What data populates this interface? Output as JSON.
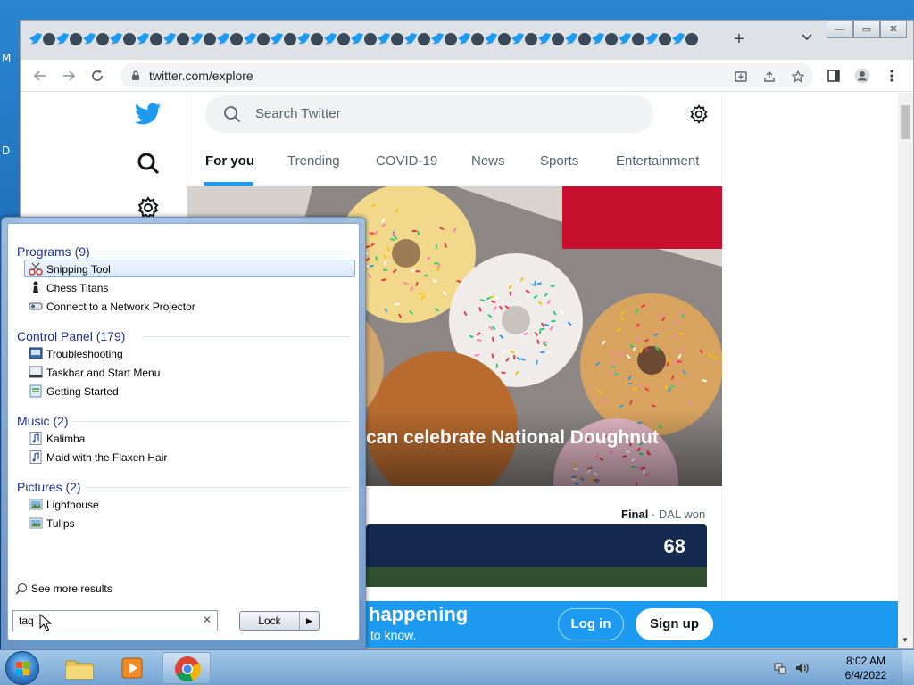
{
  "desktop": {
    "left_chars": [
      "M",
      "D"
    ]
  },
  "browser": {
    "tab_count_icons": 50,
    "url": "twitter.com/explore",
    "window_buttons": [
      "—",
      "▭",
      "✕"
    ],
    "window_buttons_inner": [
      "—",
      "▭",
      "✕"
    ]
  },
  "twitter": {
    "search_placeholder": "Search Twitter",
    "tabs": [
      "For you",
      "Trending",
      "COVID-19",
      "News",
      "Sports",
      "Entertainment"
    ],
    "hero_title": "can celebrate National Doughnut",
    "score_status": "Final",
    "score_result": "· DAL won",
    "score_value": "68",
    "banner_title": "happening",
    "banner_sub": "to know.",
    "login_label": "Log in",
    "signup_label": "Sign up",
    "accent_color": "#1d9bf0"
  },
  "start_menu": {
    "groups": [
      {
        "title": "Programs (9)",
        "items": [
          "Snipping Tool",
          "Chess Titans",
          "Connect to a Network Projector"
        ]
      },
      {
        "title": "Control Panel (179)",
        "items": [
          "Troubleshooting",
          "Taskbar and Start Menu",
          "Getting Started"
        ]
      },
      {
        "title": "Music (2)",
        "items": [
          "Kalimba",
          "Maid with the Flaxen Hair"
        ]
      },
      {
        "title": "Pictures (2)",
        "items": [
          "Lighthouse",
          "Tulips"
        ]
      }
    ],
    "selected_item": "Snipping Tool",
    "see_more": "See more results",
    "search_value": "taq",
    "clear_glyph": "✕",
    "lock_label": "Lock",
    "lock_arrow": "▶"
  },
  "taskbar": {
    "time": "8:02 AM",
    "date": "6/4/2022"
  }
}
